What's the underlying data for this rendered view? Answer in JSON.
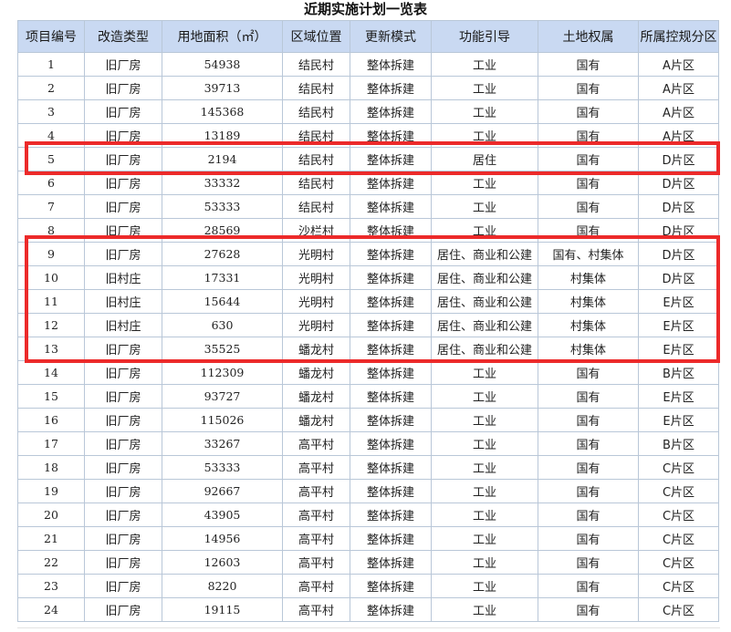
{
  "title": "近期实施计划一览表",
  "headers": [
    "项目编号",
    "改造类型",
    "用地面积（㎡）",
    "区域位置",
    "更新模式",
    "功能引导",
    "土地权属",
    "所属控规分区"
  ],
  "rows": [
    [
      "1",
      "旧厂房",
      "54938",
      "结民村",
      "整体拆建",
      "工业",
      "国有",
      "A片区"
    ],
    [
      "2",
      "旧厂房",
      "39713",
      "结民村",
      "整体拆建",
      "工业",
      "国有",
      "A片区"
    ],
    [
      "3",
      "旧厂房",
      "145368",
      "结民村",
      "整体拆建",
      "工业",
      "国有",
      "A片区"
    ],
    [
      "4",
      "旧厂房",
      "13189",
      "结民村",
      "整体拆建",
      "工业",
      "国有",
      "A片区"
    ],
    [
      "5",
      "旧厂房",
      "2194",
      "结民村",
      "整体拆建",
      "居住",
      "国有",
      "D片区"
    ],
    [
      "6",
      "旧厂房",
      "33332",
      "结民村",
      "整体拆建",
      "工业",
      "国有",
      "D片区"
    ],
    [
      "7",
      "旧厂房",
      "53333",
      "结民村",
      "整体拆建",
      "工业",
      "国有",
      "D片区"
    ],
    [
      "8",
      "旧厂房",
      "28569",
      "沙栏村",
      "整体拆建",
      "工业",
      "国有",
      "D片区"
    ],
    [
      "9",
      "旧厂房",
      "27628",
      "光明村",
      "整体拆建",
      "居住、商业和公建",
      "国有、村集体",
      "D片区"
    ],
    [
      "10",
      "旧村庄",
      "17331",
      "光明村",
      "整体拆建",
      "居住、商业和公建",
      "村集体",
      "D片区"
    ],
    [
      "11",
      "旧村庄",
      "15644",
      "光明村",
      "整体拆建",
      "居住、商业和公建",
      "村集体",
      "E片区"
    ],
    [
      "12",
      "旧村庄",
      "630",
      "光明村",
      "整体拆建",
      "居住、商业和公建",
      "村集体",
      "E片区"
    ],
    [
      "13",
      "旧厂房",
      "35525",
      "蟠龙村",
      "整体拆建",
      "居住、商业和公建",
      "村集体",
      "E片区"
    ],
    [
      "14",
      "旧厂房",
      "112309",
      "蟠龙村",
      "整体拆建",
      "工业",
      "国有",
      "B片区"
    ],
    [
      "15",
      "旧厂房",
      "93727",
      "蟠龙村",
      "整体拆建",
      "工业",
      "国有",
      "E片区"
    ],
    [
      "16",
      "旧厂房",
      "115026",
      "蟠龙村",
      "整体拆建",
      "工业",
      "国有",
      "E片区"
    ],
    [
      "17",
      "旧厂房",
      "33267",
      "高平村",
      "整体拆建",
      "工业",
      "国有",
      "B片区"
    ],
    [
      "18",
      "旧厂房",
      "53333",
      "高平村",
      "整体拆建",
      "工业",
      "国有",
      "C片区"
    ],
    [
      "19",
      "旧厂房",
      "92667",
      "高平村",
      "整体拆建",
      "工业",
      "国有",
      "C片区"
    ],
    [
      "20",
      "旧厂房",
      "43905",
      "高平村",
      "整体拆建",
      "工业",
      "国有",
      "C片区"
    ],
    [
      "21",
      "旧厂房",
      "14956",
      "高平村",
      "整体拆建",
      "工业",
      "国有",
      "C片区"
    ],
    [
      "22",
      "旧厂房",
      "12603",
      "高平村",
      "整体拆建",
      "工业",
      "国有",
      "C片区"
    ],
    [
      "23",
      "旧厂房",
      "8220",
      "高平村",
      "整体拆建",
      "工业",
      "国有",
      "C片区"
    ],
    [
      "24",
      "旧厂房",
      "19115",
      "高平村",
      "整体拆建",
      "工业",
      "国有",
      "C片区"
    ]
  ],
  "highlight_color": "#ec2a2a",
  "highlighted_row_groups": [
    [
      "5"
    ],
    [
      "9",
      "10",
      "11",
      "12",
      "13"
    ]
  ]
}
